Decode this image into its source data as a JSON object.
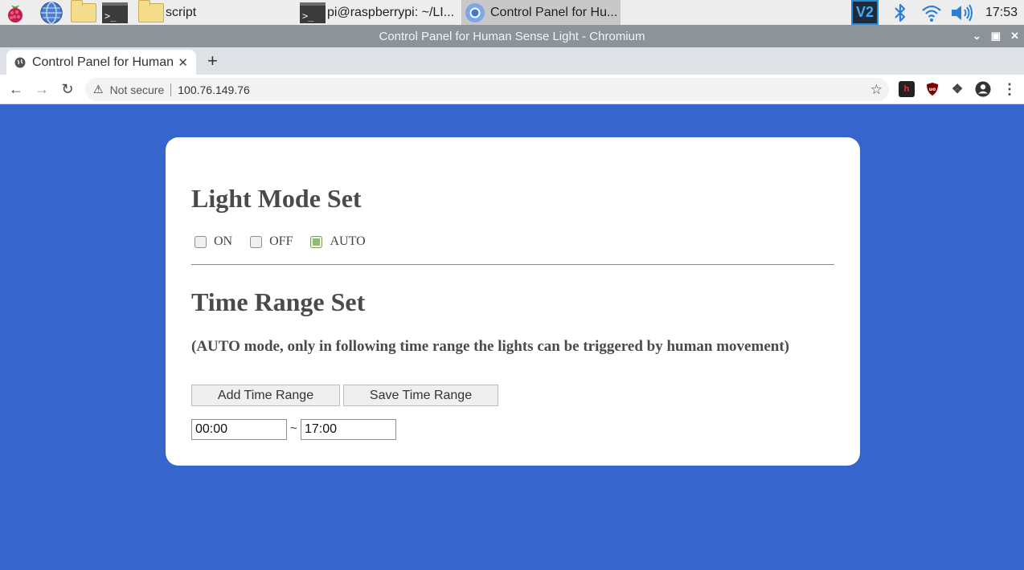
{
  "taskbar": {
    "folder_window": "script",
    "terminal_window": "pi@raspberrypi: ~/LI...",
    "browser_window": "Control Panel for Hu...",
    "tray_vnc": "V2",
    "clock": "17:53"
  },
  "browser": {
    "window_title": "Control Panel for Human Sense Light - Chromium",
    "tab_title": "Control Panel for Human Sense Light",
    "security_label": "Not secure",
    "url": "100.76.149.76"
  },
  "page": {
    "light_mode_title": "Light Mode Set",
    "modes": [
      {
        "label": "ON",
        "checked": false
      },
      {
        "label": "OFF",
        "checked": false
      },
      {
        "label": "AUTO",
        "checked": true
      }
    ],
    "time_range_title": "Time Range Set",
    "note": "(AUTO mode, only in following time range the lights can be triggered by human movement)",
    "add_button": "Add Time Range",
    "save_button": "Save Time Range",
    "range": {
      "start": "00:00",
      "separator": "~",
      "end": "17:00"
    }
  },
  "colors": {
    "page_background": "#3665cd",
    "checked_fill": "#8ec06c"
  }
}
